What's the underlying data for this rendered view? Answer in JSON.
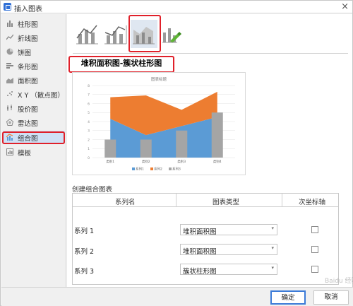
{
  "window": {
    "title": "插入图表",
    "close_glyph": "×"
  },
  "sidebar": {
    "items": [
      {
        "label": "柱形图",
        "icon": "column-chart-icon"
      },
      {
        "label": "折线图",
        "icon": "line-chart-icon"
      },
      {
        "label": "饼图",
        "icon": "pie-chart-icon"
      },
      {
        "label": "条形图",
        "icon": "bar-chart-icon"
      },
      {
        "label": "面积图",
        "icon": "area-chart-icon"
      },
      {
        "label": "X Y （散点图）",
        "icon": "scatter-chart-icon"
      },
      {
        "label": "股价图",
        "icon": "stock-chart-icon"
      },
      {
        "label": "雷达图",
        "icon": "radar-chart-icon"
      },
      {
        "label": "组合图",
        "icon": "combo-chart-icon",
        "active": true
      },
      {
        "label": "模板",
        "icon": "template-icon"
      }
    ]
  },
  "subtypes": {
    "items": [
      "clustered-column-line-icon",
      "column-line-secondary-axis-icon",
      "stacked-area-clustered-column-icon",
      "custom-combination-icon"
    ],
    "selected": 2
  },
  "section_title": "堆积面积图-簇状柱形图",
  "preview": {
    "title": "图表标题",
    "legend": [
      "系列1",
      "系列2",
      "系列3"
    ]
  },
  "chart_data": {
    "type": "area",
    "title": "图表标题",
    "categories": [
      "类别1",
      "类别2",
      "类别3",
      "类别4"
    ],
    "ylim": [
      0,
      8
    ],
    "yticks": [
      "0",
      "1",
      "2",
      "3",
      "4",
      "5",
      "6",
      "7",
      "8"
    ],
    "series": [
      {
        "name": "系列1",
        "type": "stacked-area",
        "values": [
          4.3,
          2.5,
          3.5,
          4.5
        ],
        "color": "#5b9bd5"
      },
      {
        "name": "系列2",
        "type": "stacked-area",
        "values": [
          2.4,
          4.4,
          1.8,
          2.8
        ],
        "color": "#ed7d31"
      },
      {
        "name": "系列3",
        "type": "clustered-column",
        "values": [
          2,
          2,
          3,
          5
        ],
        "color": "#a5a5a5"
      }
    ],
    "grid": true,
    "legend_position": "bottom"
  },
  "combo": {
    "label": "创建组合图表",
    "headers": {
      "name": "系列名",
      "type": "图表类型",
      "secondary": "次坐标轴"
    },
    "rows": [
      {
        "name": "系列 1",
        "type": "堆积面积图",
        "secondary": false
      },
      {
        "name": "系列 2",
        "type": "堆积面积图",
        "secondary": false
      },
      {
        "name": "系列 3",
        "type": "簇状柱形图",
        "secondary": false
      }
    ],
    "dropdown_glyph": "▾"
  },
  "footer": {
    "ok": "确定",
    "cancel": "取消"
  },
  "watermark": "Baidu 经验",
  "colors": {
    "highlight": "#e0202a",
    "accent": "#3c7bd8",
    "series1": "#5b9bd5",
    "series2": "#ed7d31",
    "series3": "#a5a5a5"
  }
}
